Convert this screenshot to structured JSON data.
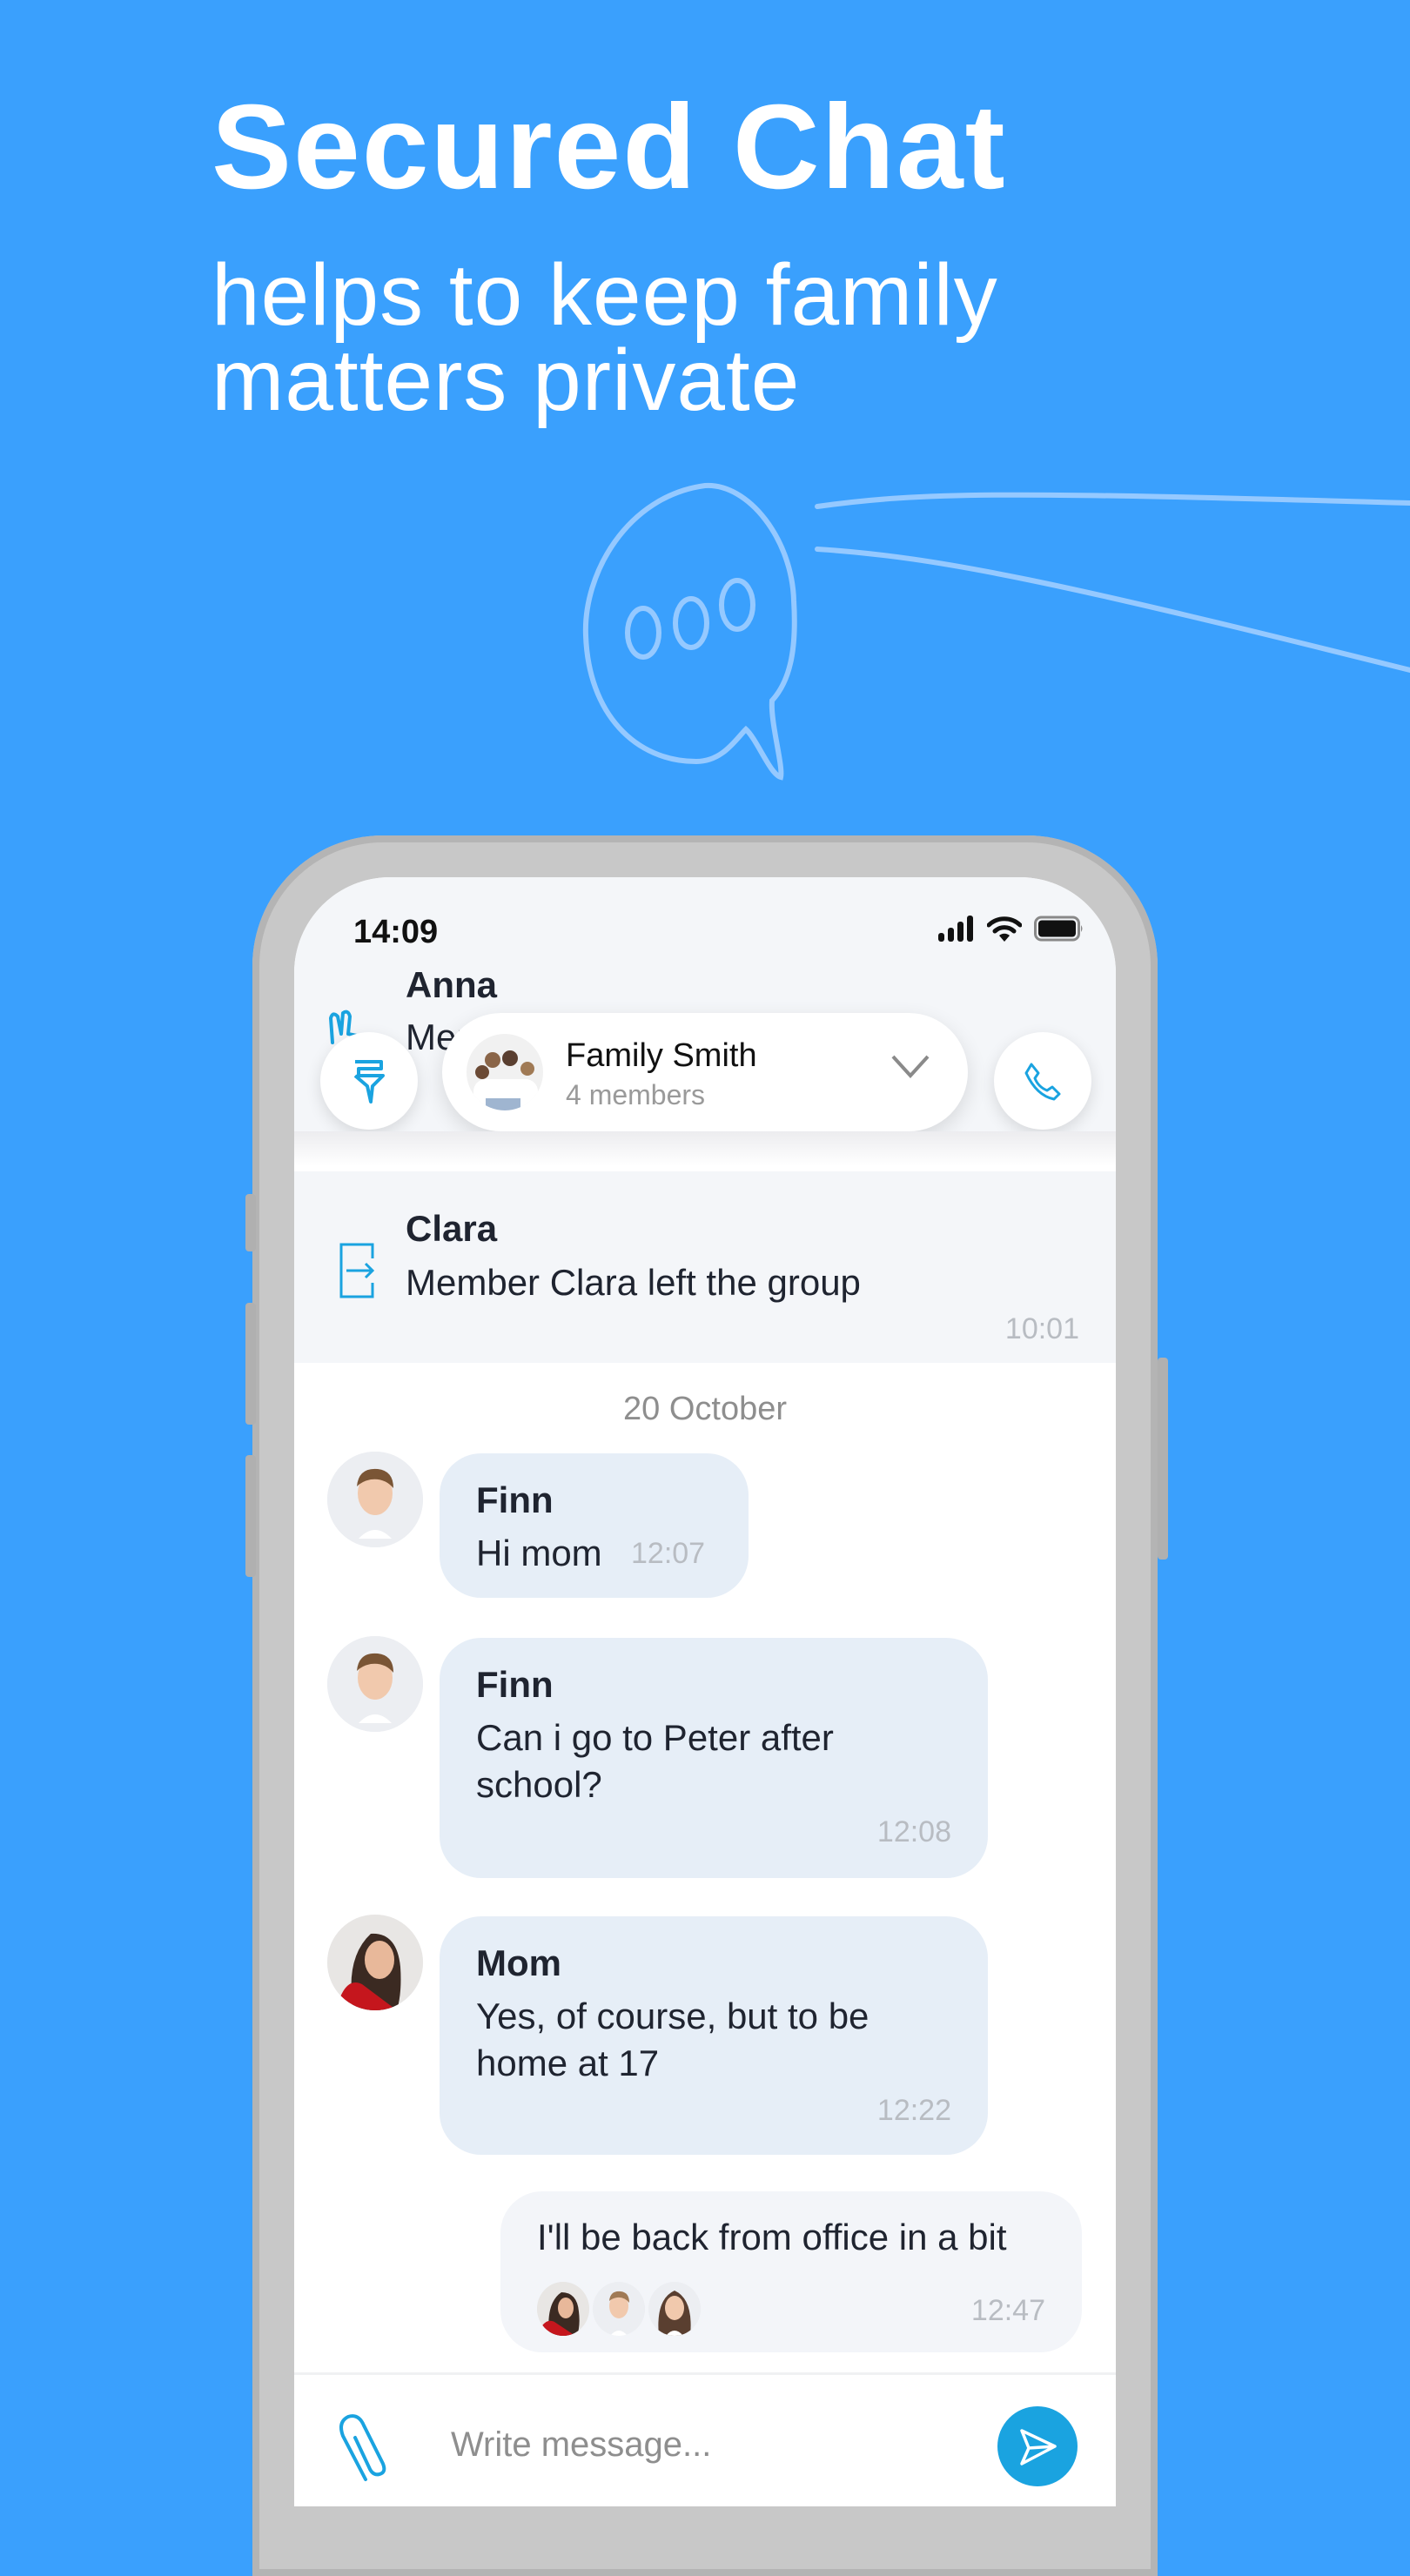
{
  "hero": {
    "title": "Secured Chat",
    "subtitle_line1": "helps to keep family",
    "subtitle_line2": "matters private"
  },
  "colors": {
    "background": "#3aa0fd",
    "accent": "#1aa3e0",
    "bubble_incoming": "#e6eef7",
    "bubble_outgoing": "#f3f5f9"
  },
  "status_bar": {
    "time": "14:09",
    "icons": [
      "signal-icon",
      "wifi-icon",
      "battery-icon"
    ]
  },
  "header": {
    "filter_icon": "brush-filter-icon",
    "group_name": "Family Smith",
    "member_count": "4 members",
    "dropdown_icon": "chevron-down-icon",
    "call_icon": "phone-icon"
  },
  "background_message": {
    "name": "Anna",
    "text": "Member Anna joined the group!"
  },
  "system_message": {
    "name": "Clara",
    "text": "Member Clara left the group",
    "time": "10:01",
    "icon": "exit-icon"
  },
  "date_separator": "20 October",
  "messages": [
    {
      "sender": "Finn",
      "text": "Hi mom",
      "time": "12:07",
      "direction": "incoming"
    },
    {
      "sender": "Finn",
      "text": "Can i go to Peter after school?",
      "time": "12:08",
      "direction": "incoming"
    },
    {
      "sender": "Mom",
      "text": "Yes, of course, but to be home at 17",
      "time": "12:22",
      "direction": "incoming"
    },
    {
      "sender": "",
      "text": "I'll be back from office in a bit",
      "time": "12:47",
      "direction": "outgoing",
      "read_by": [
        "Mom",
        "Finn",
        "Daughter"
      ]
    }
  ],
  "composer": {
    "placeholder": "Write message...",
    "value": "",
    "attach_icon": "paperclip-icon",
    "send_icon": "send-icon"
  }
}
